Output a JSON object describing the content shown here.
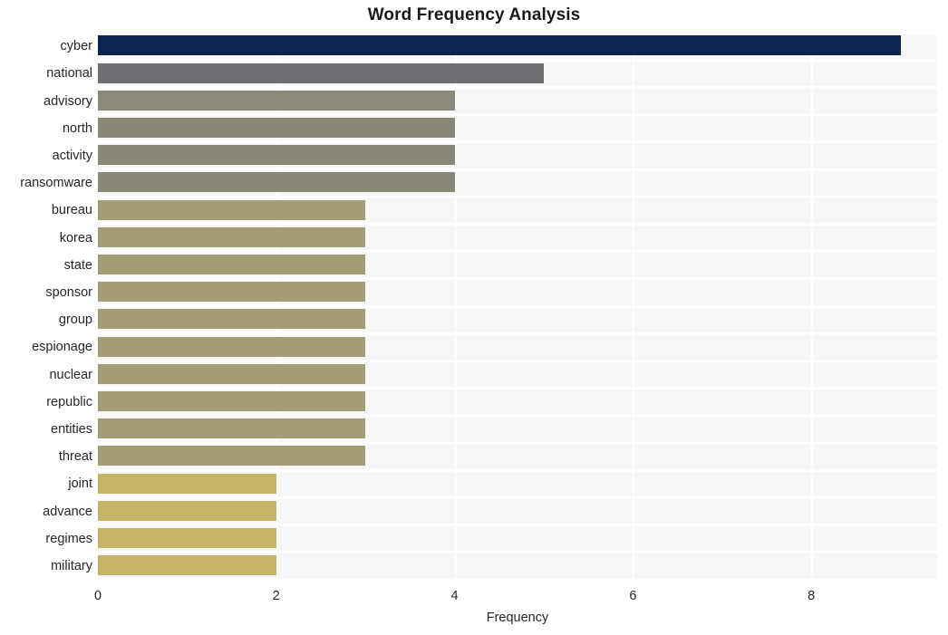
{
  "chart_data": {
    "type": "bar",
    "orientation": "horizontal",
    "title": "Word Frequency Analysis",
    "xlabel": "Frequency",
    "ylabel": "",
    "xlim": [
      0,
      9.4
    ],
    "ylim": [
      0,
      20
    ],
    "xticks": [
      0,
      2,
      4,
      6,
      8
    ],
    "xtick_labels": [
      "0",
      "2",
      "4",
      "6",
      "8"
    ],
    "grid": true,
    "grid_color": "#ffffff",
    "plot_background": "#f7f7f8",
    "figure_background": "#ffffff",
    "legend": null,
    "categories": [
      "cyber",
      "national",
      "advisory",
      "north",
      "activity",
      "ransomware",
      "bureau",
      "korea",
      "state",
      "sponsor",
      "group",
      "espionage",
      "nuclear",
      "republic",
      "entities",
      "threat",
      "joint",
      "advance",
      "regimes",
      "military"
    ],
    "values": [
      9,
      5,
      4,
      4,
      4,
      4,
      3,
      3,
      3,
      3,
      3,
      3,
      3,
      3,
      3,
      3,
      2,
      2,
      2,
      2
    ],
    "bar_colors": [
      "#0b2450",
      "#6e6f73",
      "#8b8979",
      "#8a8878",
      "#8a8878",
      "#8a8878",
      "#a39d76",
      "#a39d76",
      "#a39d76",
      "#a39d76",
      "#a39d76",
      "#a39d76",
      "#a39d76",
      "#a39d76",
      "#a39d76",
      "#a39d76",
      "#c5b465",
      "#c5b465",
      "#c5b465",
      "#c5b465"
    ]
  },
  "axis": {
    "x_title": "Frequency"
  }
}
